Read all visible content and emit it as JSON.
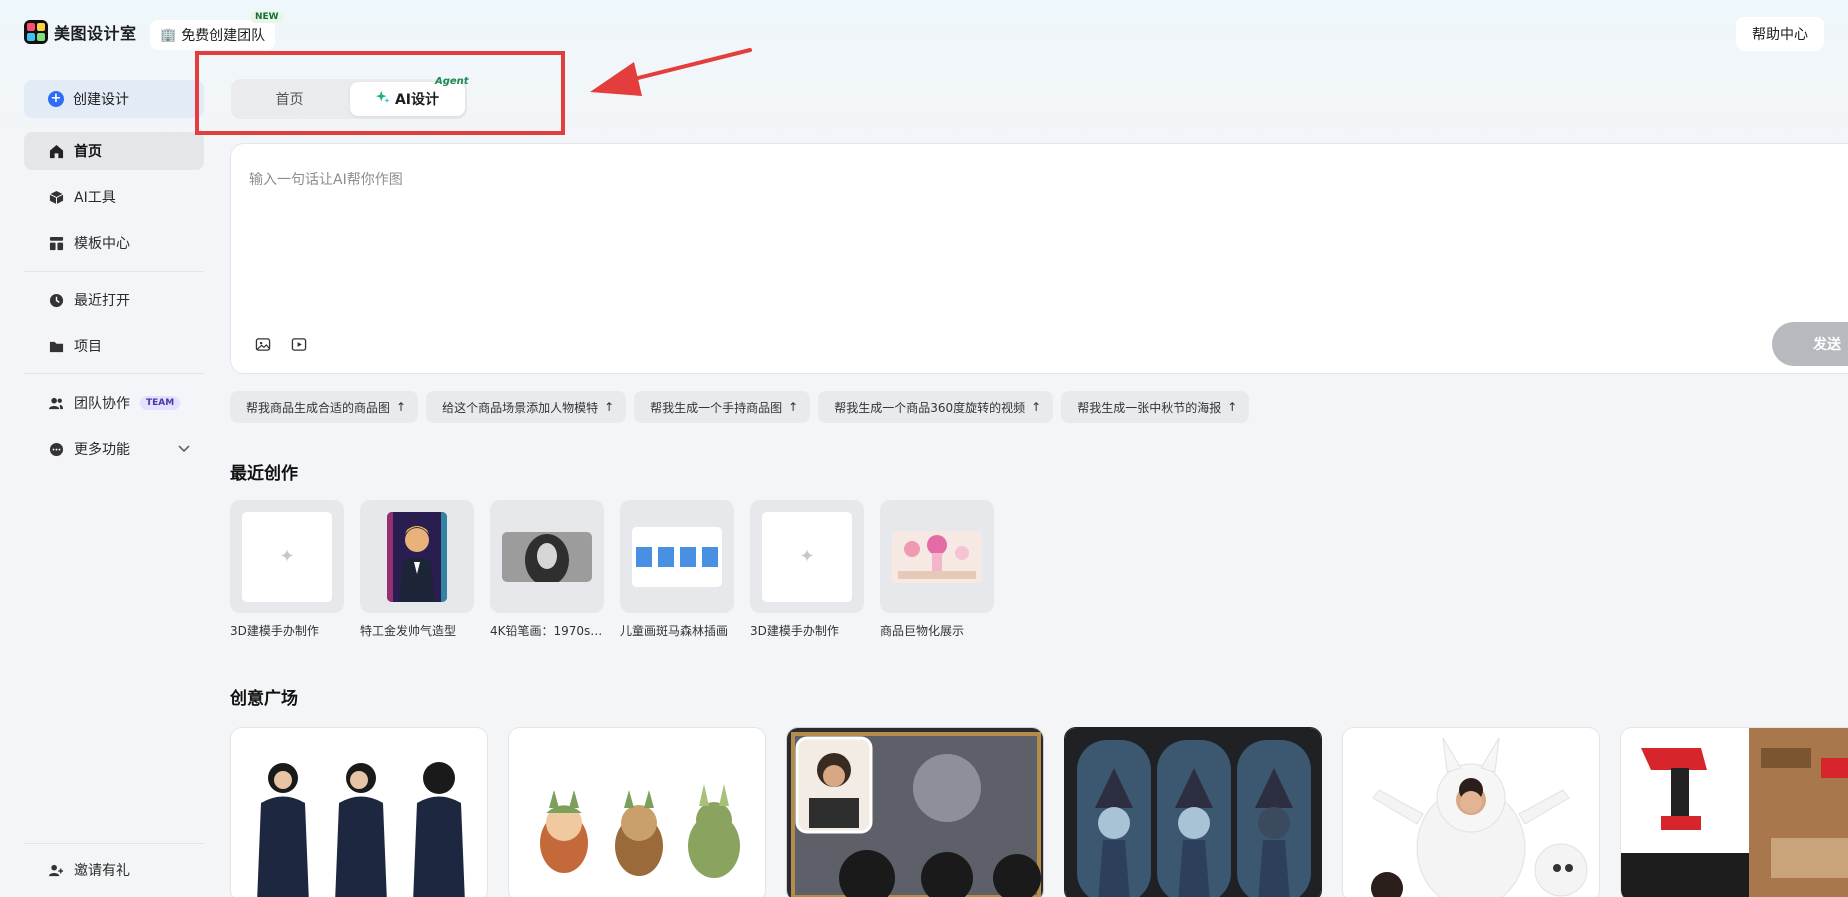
{
  "app": {
    "name": "美图设计室",
    "team_button": "免费创建团队",
    "team_badge": "NEW",
    "help": "帮助中心"
  },
  "sidebar": {
    "create": "创建设计",
    "items": [
      {
        "label": "首页",
        "icon": "home-icon"
      },
      {
        "label": "AI工具",
        "icon": "cube-icon"
      },
      {
        "label": "模板中心",
        "icon": "template-icon"
      },
      {
        "label": "最近打开",
        "icon": "clock-icon"
      },
      {
        "label": "项目",
        "icon": "folder-icon"
      },
      {
        "label": "团队协作",
        "icon": "team-icon",
        "tag": "TEAM"
      },
      {
        "label": "更多功能",
        "icon": "more-icon"
      }
    ],
    "invite": "邀请有礼"
  },
  "tabs": {
    "home": "首页",
    "ai": "AI设计",
    "agent": "Agent"
  },
  "prompt": {
    "placeholder": "输入一句话让AI帮你作图",
    "send": "发送"
  },
  "suggestions": [
    "帮我商品生成合适的商品图",
    "给这个商品场景添加人物模特",
    "帮我生成一个手持商品图",
    "帮我生成一个商品360度旋转的视频",
    "帮我生成一张中秋节的海报"
  ],
  "recent": {
    "title": "最近创作",
    "items": [
      {
        "label": "3D建模手办制作"
      },
      {
        "label": "特工金发帅气造型"
      },
      {
        "label": "4K铅笔画：1970s…"
      },
      {
        "label": "儿童画斑马森林插画"
      },
      {
        "label": "3D建模手办制作"
      },
      {
        "label": "商品巨物化展示"
      }
    ]
  },
  "gallery": {
    "title": "创意广场"
  },
  "colors": {
    "accent": "#2f6cf6",
    "highlight": "#e43d3d",
    "agent": "#1c8a52"
  }
}
